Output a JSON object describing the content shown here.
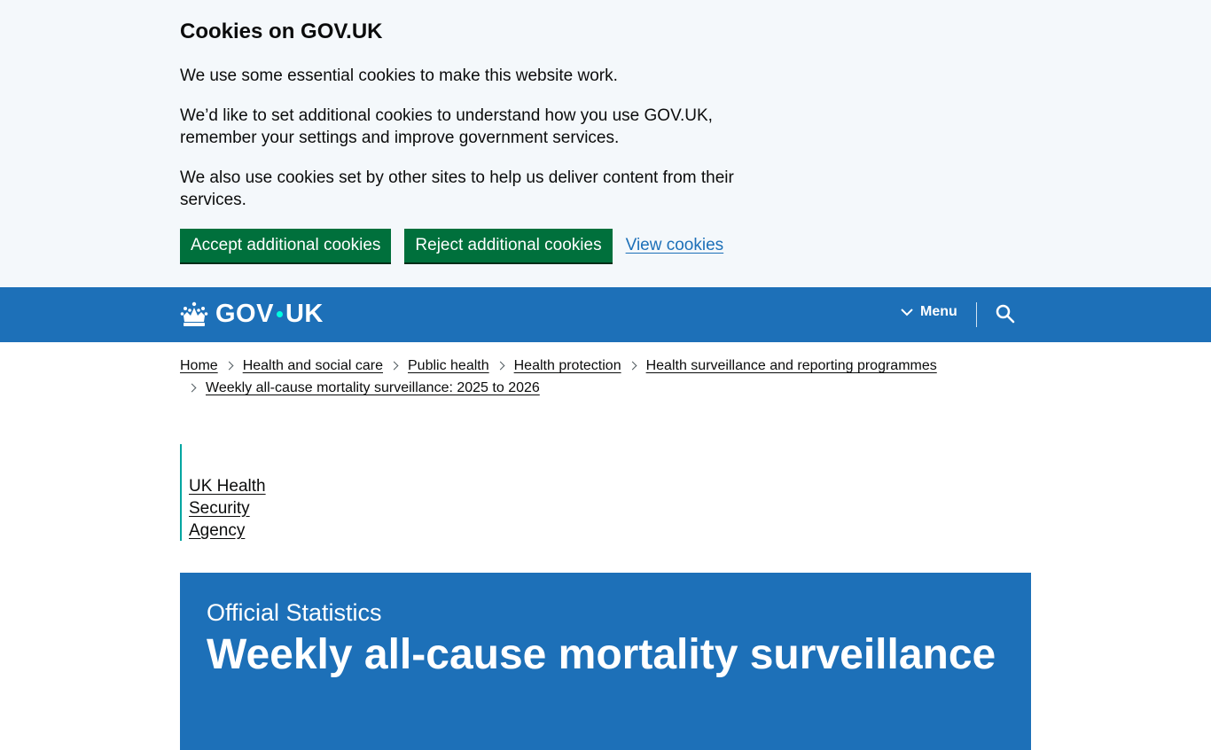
{
  "cookie_banner": {
    "heading": "Cookies on GOV.UK",
    "paragraph_1": "We use some essential cookies to make this website work.",
    "paragraph_2": "We’d like to set additional cookies to understand how you use GOV.UK, remember your settings and improve government services.",
    "paragraph_3": "We also use cookies set by other sites to help us deliver content from their services.",
    "accept_label": "Accept additional cookies",
    "reject_label": "Reject additional cookies",
    "view_label": "View cookies"
  },
  "header": {
    "logo_part1": "GOV",
    "logo_part2": "UK",
    "menu_label": "Menu",
    "menu_icon": "chevron-down-icon",
    "search_icon": "search-icon",
    "crown_icon": "crown-icon"
  },
  "breadcrumbs": {
    "items": [
      "Home",
      "Health and social care",
      "Public health",
      "Health protection",
      "Health surveillance and reporting programmes",
      "Weekly all-cause mortality surveillance: 2025 to 2026"
    ]
  },
  "organisation": {
    "line1": "UK Health",
    "line2": "Security",
    "line3": "Agency"
  },
  "title_block": {
    "document_type": "Official Statistics",
    "title": "Weekly all-cause mortality surveillance"
  },
  "colors": {
    "brand_blue": "#1d70b8",
    "button_green": "#00703c",
    "link_blue": "#1d70b8",
    "banner_bg": "#f4f8fb",
    "org_stripe": "#00a5a1"
  }
}
